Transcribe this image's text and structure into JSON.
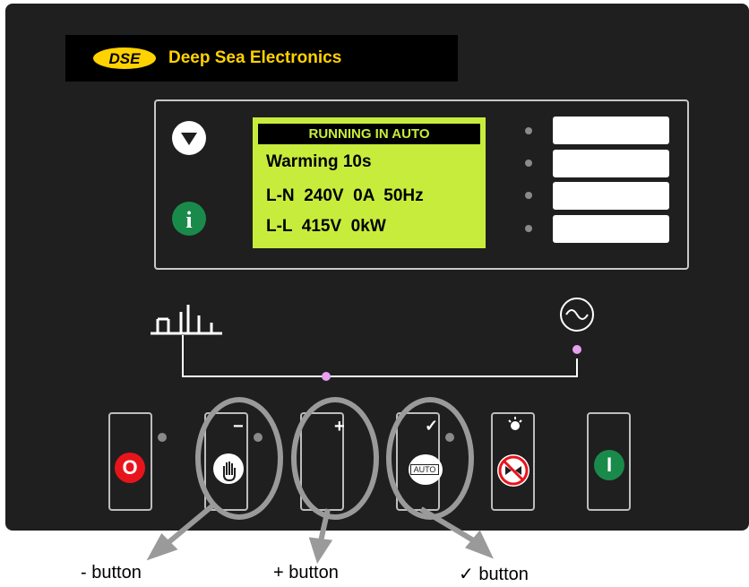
{
  "brand": {
    "name": "Deep Sea Electronics",
    "logo": "DSE"
  },
  "lcd": {
    "banner": "RUNNING IN AUTO",
    "lines": [
      "Warming 10s",
      "L-N  240V  0A  50Hz",
      "L-L  415V  0kW"
    ]
  },
  "side_buttons": [
    {
      "icon": "scroll-down-icon"
    },
    {
      "icon": "info-icon",
      "glyph": "i"
    }
  ],
  "keys": [
    {
      "icon": "stop-icon",
      "glyph": "O"
    },
    {
      "icon": "manual-hand-icon",
      "glyph": "−"
    },
    {
      "icon": "plus-icon",
      "glyph": "+"
    },
    {
      "icon": "auto-mode-icon",
      "glyph": "✓",
      "badge": "AUTO"
    },
    {
      "icon": "alarm-mute-icon"
    },
    {
      "icon": "start-icon",
      "glyph": "I"
    }
  ],
  "captions": {
    "minus": "- button",
    "plus": "+ button",
    "check": "✓ button"
  },
  "colors": {
    "panel": "#1f1f1f",
    "lcd": "#c8ec3c",
    "brand_text": "#ffd200",
    "stop": "#e8141c",
    "start": "#1a8a4a",
    "info": "#1a8a4a",
    "highlight": "#9a9a9a",
    "bus_dot": "#e8a0f0"
  }
}
